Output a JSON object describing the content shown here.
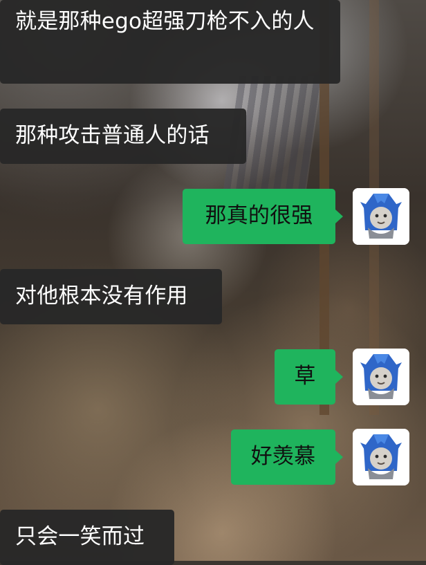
{
  "messages": [
    {
      "direction": "incoming",
      "text": "就是那种ego超强刀枪不入的人"
    },
    {
      "direction": "incoming",
      "text": "那种攻击普通人的话"
    },
    {
      "direction": "outgoing",
      "text": "那真的很强",
      "avatar_icon": "shark-hood-avatar-icon"
    },
    {
      "direction": "incoming",
      "text": "对他根本没有作用"
    },
    {
      "direction": "outgoing",
      "text": "草",
      "avatar_icon": "shark-hood-avatar-icon"
    },
    {
      "direction": "outgoing",
      "text": "好羡慕",
      "avatar_icon": "shark-hood-avatar-icon"
    },
    {
      "direction": "incoming",
      "text": "只会一笑而过"
    }
  ],
  "colors": {
    "incoming_bubble": "#282828",
    "outgoing_bubble": "#1fb45d",
    "incoming_text": "#ffffff",
    "outgoing_text": "#101010"
  }
}
